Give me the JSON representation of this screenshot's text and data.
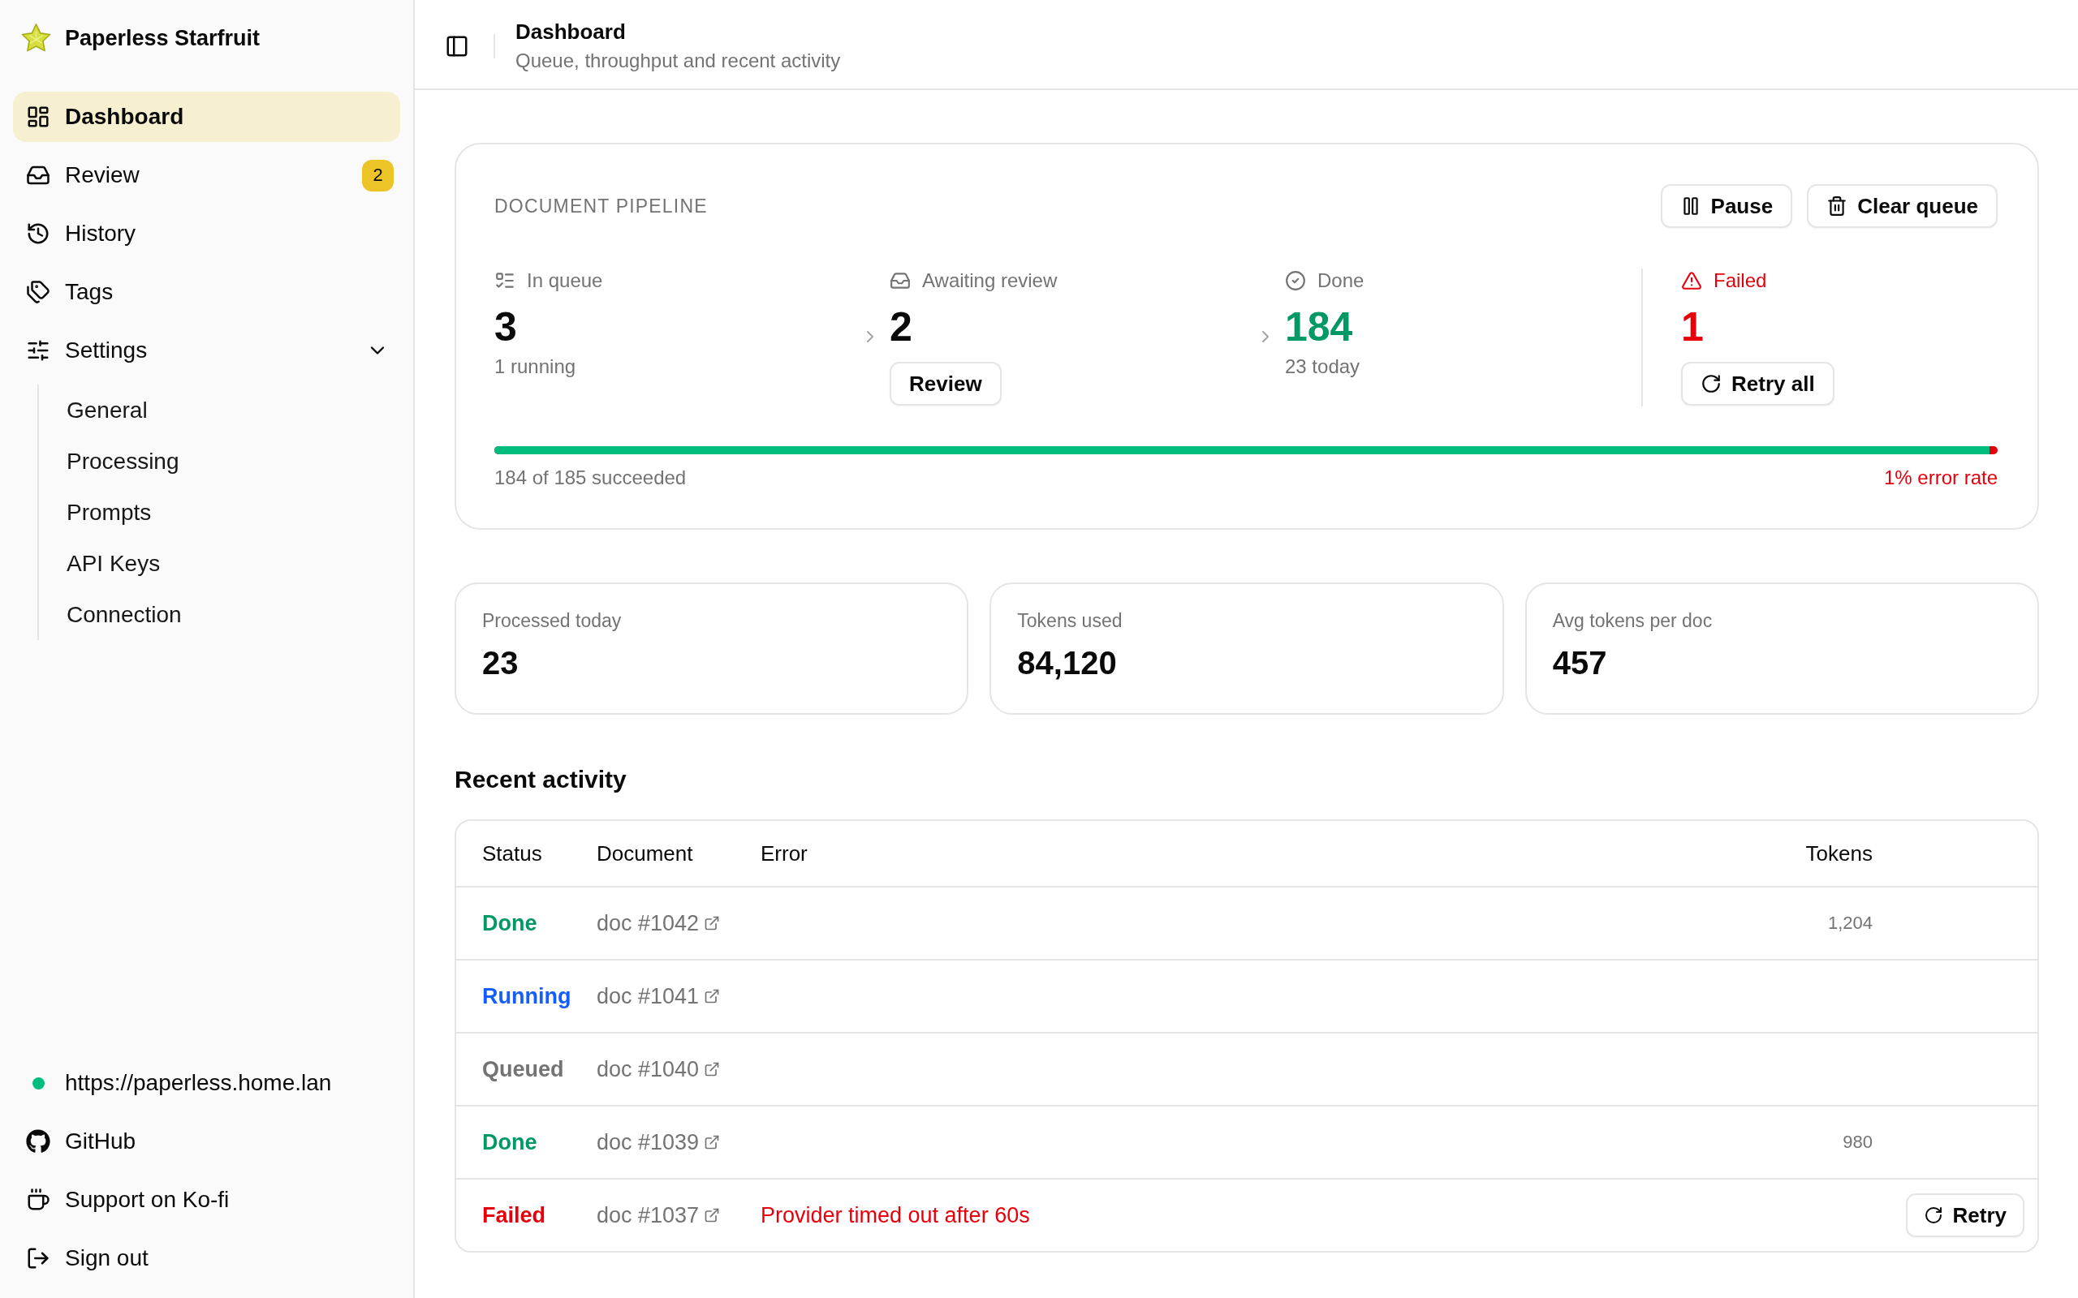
{
  "sidebar": {
    "brand": "Paperless Starfruit",
    "nav": [
      {
        "label": "Dashboard",
        "selected": true
      },
      {
        "label": "Review",
        "selected": false,
        "badge": "2"
      },
      {
        "label": "History",
        "selected": false
      },
      {
        "label": "Tags",
        "selected": false
      },
      {
        "label": "Settings",
        "selected": false,
        "expanded": true,
        "children": [
          {
            "label": "General",
            "selected": false
          },
          {
            "label": "Processing",
            "selected": false
          },
          {
            "label": "Prompts",
            "selected": false
          },
          {
            "label": "API Keys",
            "selected": false
          },
          {
            "label": "Connection",
            "selected": false
          }
        ]
      }
    ],
    "footer": [
      {
        "kind": "connection",
        "label": "https://paperless.home.lan",
        "connected": true
      },
      {
        "kind": "link",
        "label": "GitHub"
      },
      {
        "kind": "link",
        "label": "Support on Ko-fi"
      },
      {
        "kind": "link",
        "label": "Sign out"
      }
    ]
  },
  "header": {
    "title": "Dashboard",
    "subtitle": "Queue, throughput and recent activity"
  },
  "pipeline": {
    "title": "DOCUMENT PIPELINE",
    "actions": [
      "Pause",
      "Clear queue"
    ],
    "stages": [
      {
        "kind": "queued",
        "label": "In queue",
        "count": "3",
        "note": "1 running"
      },
      {
        "kind": "review",
        "label": "Awaiting review",
        "count": "2",
        "action": "Review"
      },
      {
        "kind": "done",
        "label": "Done",
        "count": "184",
        "note": "23 today"
      },
      {
        "kind": "failed",
        "label": "Failed",
        "count": "1",
        "action": "Retry all"
      }
    ],
    "progress": {
      "level": 0.9946,
      "caption": "184 of 185 succeeded",
      "error_rate": "1% error rate"
    }
  },
  "stats": [
    {
      "label": "Processed today",
      "value": "23"
    },
    {
      "label": "Tokens used",
      "value": "84,120"
    },
    {
      "label": "Avg tokens per doc",
      "value": "457"
    }
  ],
  "activity": {
    "title": "Recent activity",
    "columns": [
      "Status",
      "Document",
      "Error",
      "Tokens"
    ],
    "rows": [
      {
        "kind": "done",
        "status": "Done",
        "document": "doc #1042",
        "tokens": "1,204"
      },
      {
        "kind": "running",
        "status": "Running",
        "document": "doc #1041"
      },
      {
        "kind": "queued",
        "status": "Queued",
        "document": "doc #1040"
      },
      {
        "kind": "done",
        "status": "Done",
        "document": "doc #1039",
        "tokens": "980"
      },
      {
        "kind": "failed",
        "status": "Failed",
        "document": "doc #1037",
        "error": "Provider timed out after 60s",
        "action": "Retry"
      }
    ]
  }
}
